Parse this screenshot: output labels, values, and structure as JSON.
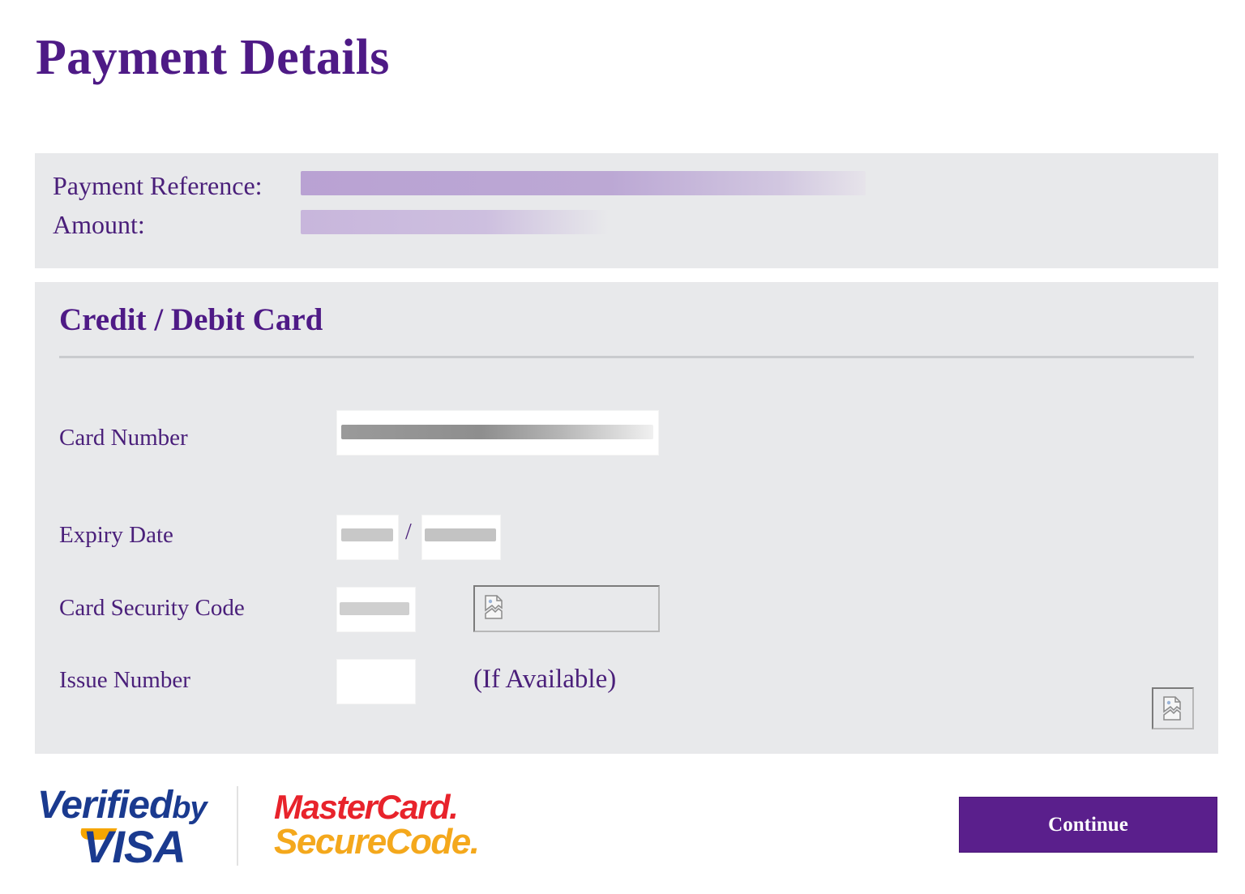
{
  "page": {
    "title": "Payment Details"
  },
  "summary": {
    "reference_label": "Payment Reference:",
    "amount_label": "Amount:"
  },
  "card": {
    "heading": "Credit / Debit Card",
    "fields": {
      "number_label": "Card Number",
      "expiry_label": "Expiry Date",
      "expiry_separator": "/",
      "security_label": "Card Security Code",
      "issue_label": "Issue Number",
      "issue_hint": "(If Available)"
    }
  },
  "logos": {
    "visa_verified": "Verified",
    "visa_by": "by",
    "visa_name": "VISA",
    "mc_master": "MasterCard.",
    "mc_secure": "SecureCode."
  },
  "actions": {
    "continue_label": "Continue"
  },
  "colors": {
    "brand_purple": "#4e1a86",
    "button_purple": "#5a1f8c",
    "panel_gray": "#e8e9eb",
    "visa_blue": "#1a3a8f",
    "mc_red": "#e8232b",
    "mc_orange": "#f4a81c"
  },
  "icons": {
    "broken_image": "broken-image-icon"
  }
}
